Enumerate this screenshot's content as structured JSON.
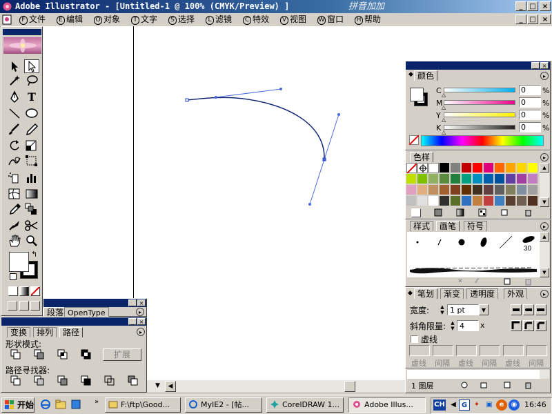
{
  "window": {
    "title": "Adobe Illustrator - [Untitled-1 @ 100% (CMYK/Preview) ]",
    "ime_overlay": "拼音加加",
    "min": "_",
    "max": "□",
    "close": "×"
  },
  "menu": [
    {
      "key": "F",
      "label": "文件"
    },
    {
      "key": "E",
      "label": "编辑"
    },
    {
      "key": "O",
      "label": "对象"
    },
    {
      "key": "T",
      "label": "文字"
    },
    {
      "key": "S",
      "label": "选择"
    },
    {
      "key": "L",
      "label": "滤镜"
    },
    {
      "key": "C",
      "label": "特效"
    },
    {
      "key": "V",
      "label": "视图"
    },
    {
      "key": "W",
      "label": "窗口"
    },
    {
      "key": "H",
      "label": "帮助"
    }
  ],
  "tools": {
    "type": "T"
  },
  "color_panel": {
    "tab": "颜色",
    "channels": [
      {
        "label": "C",
        "value": "0",
        "unit": "%",
        "color": "#00aeef"
      },
      {
        "label": "M",
        "value": "0",
        "unit": "%",
        "color": "#ec008c"
      },
      {
        "label": "Y",
        "value": "0",
        "unit": "%",
        "color": "#fff200"
      },
      {
        "label": "K",
        "value": "0",
        "unit": "%",
        "color": "#231f20"
      }
    ]
  },
  "swatches_panel": {
    "tab": "色样",
    "colors": [
      "#000000",
      "#808080",
      "#c00000",
      "#ff0000",
      "#e0007a",
      "#ff6600",
      "#ffa500",
      "#ffd700",
      "#ffff00",
      "#c0e000",
      "#80c000",
      "#90b060",
      "#5a8a3c",
      "#20803c",
      "#00a080",
      "#0090c0",
      "#0060b0",
      "#0050a0",
      "#6040a0",
      "#a040a0",
      "#c080c0",
      "#e0a0c0",
      "#e0b080",
      "#c09060",
      "#a06030",
      "#804020",
      "#603000",
      "#403020",
      "#604040",
      "#606060",
      "#808060",
      "#8090a0",
      "#a0a0a0",
      "#c0c0c0",
      "#e0e0e0",
      "#ffffff",
      "#303030",
      "#5a6e2a",
      "#3070c0",
      "#c08040",
      "#c04040",
      "#4080c0",
      "#5a4030",
      "#706050",
      "#503020",
      "#b0a080",
      "#806040",
      "#605040"
    ]
  },
  "brushes_panel": {
    "tabs": [
      "样式",
      "画笔",
      "符号"
    ],
    "size_label": "30"
  },
  "stroke_panel": {
    "tabs": [
      "笔划",
      "渐变",
      "透明度",
      "外观"
    ],
    "weight_label": "宽度:",
    "weight_value": "1 pt",
    "miter_label": "斜角限量:",
    "miter_value": "4",
    "miter_unit": "x",
    "dashed_label": "虚线",
    "dash_labels": [
      "虚线",
      "间隔",
      "虚线",
      "间隔",
      "虚线",
      "间隔"
    ]
  },
  "layers_panel": {
    "layer_count": "1 图层"
  },
  "left_panel_top": {
    "tabs": [
      "段落",
      "OpenType"
    ]
  },
  "pathfinder_panel": {
    "tabs": [
      "变换",
      "排列",
      "路径"
    ],
    "shape_modes_label": "形状模式:",
    "expand_button": "扩展",
    "pathfinders_label": "路径寻找器:"
  },
  "taskbar": {
    "start": "开始",
    "tasks": [
      {
        "label": "F:\\ftp\\Good..."
      },
      {
        "label": "MyIE2 - [帖..."
      },
      {
        "label": "CorelDRAW 1..."
      },
      {
        "label": "Adobe Illus..."
      }
    ],
    "ime": "CH",
    "clock": "16:46"
  }
}
